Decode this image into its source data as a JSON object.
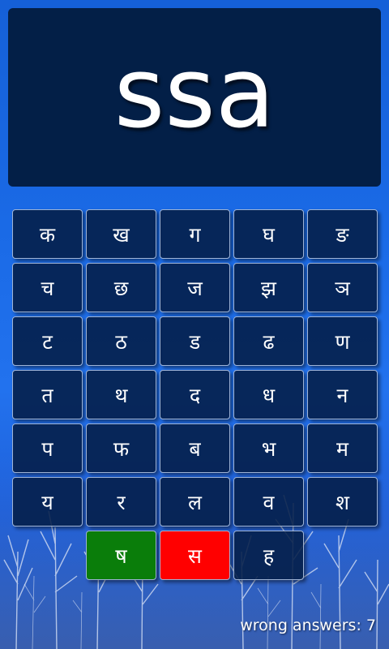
{
  "prompt": "ssa",
  "keys": [
    {
      "label": "क",
      "state": "normal"
    },
    {
      "label": "ख",
      "state": "normal"
    },
    {
      "label": "ग",
      "state": "normal"
    },
    {
      "label": "घ",
      "state": "normal"
    },
    {
      "label": "ङ",
      "state": "normal"
    },
    {
      "label": "च",
      "state": "normal"
    },
    {
      "label": "छ",
      "state": "normal"
    },
    {
      "label": "ज",
      "state": "normal"
    },
    {
      "label": "झ",
      "state": "normal"
    },
    {
      "label": "ञ",
      "state": "normal"
    },
    {
      "label": "ट",
      "state": "normal"
    },
    {
      "label": "ठ",
      "state": "normal"
    },
    {
      "label": "ड",
      "state": "normal"
    },
    {
      "label": "ढ",
      "state": "normal"
    },
    {
      "label": "ण",
      "state": "normal"
    },
    {
      "label": "त",
      "state": "normal"
    },
    {
      "label": "थ",
      "state": "normal"
    },
    {
      "label": "द",
      "state": "normal"
    },
    {
      "label": "ध",
      "state": "normal"
    },
    {
      "label": "न",
      "state": "normal"
    },
    {
      "label": "प",
      "state": "normal"
    },
    {
      "label": "फ",
      "state": "normal"
    },
    {
      "label": "ब",
      "state": "normal"
    },
    {
      "label": "भ",
      "state": "normal"
    },
    {
      "label": "म",
      "state": "normal"
    },
    {
      "label": "य",
      "state": "normal"
    },
    {
      "label": "र",
      "state": "normal"
    },
    {
      "label": "ल",
      "state": "normal"
    },
    {
      "label": "व",
      "state": "normal"
    },
    {
      "label": "श",
      "state": "normal"
    },
    {
      "label": "ष",
      "state": "correct"
    },
    {
      "label": "स",
      "state": "wrong"
    },
    {
      "label": "ह",
      "state": "normal"
    }
  ],
  "footer": {
    "wrong_answers_text": "wrong answers: 7"
  },
  "colors": {
    "correct": "#0a7d0a",
    "wrong": "#ff0000",
    "panel": "#031f47"
  }
}
